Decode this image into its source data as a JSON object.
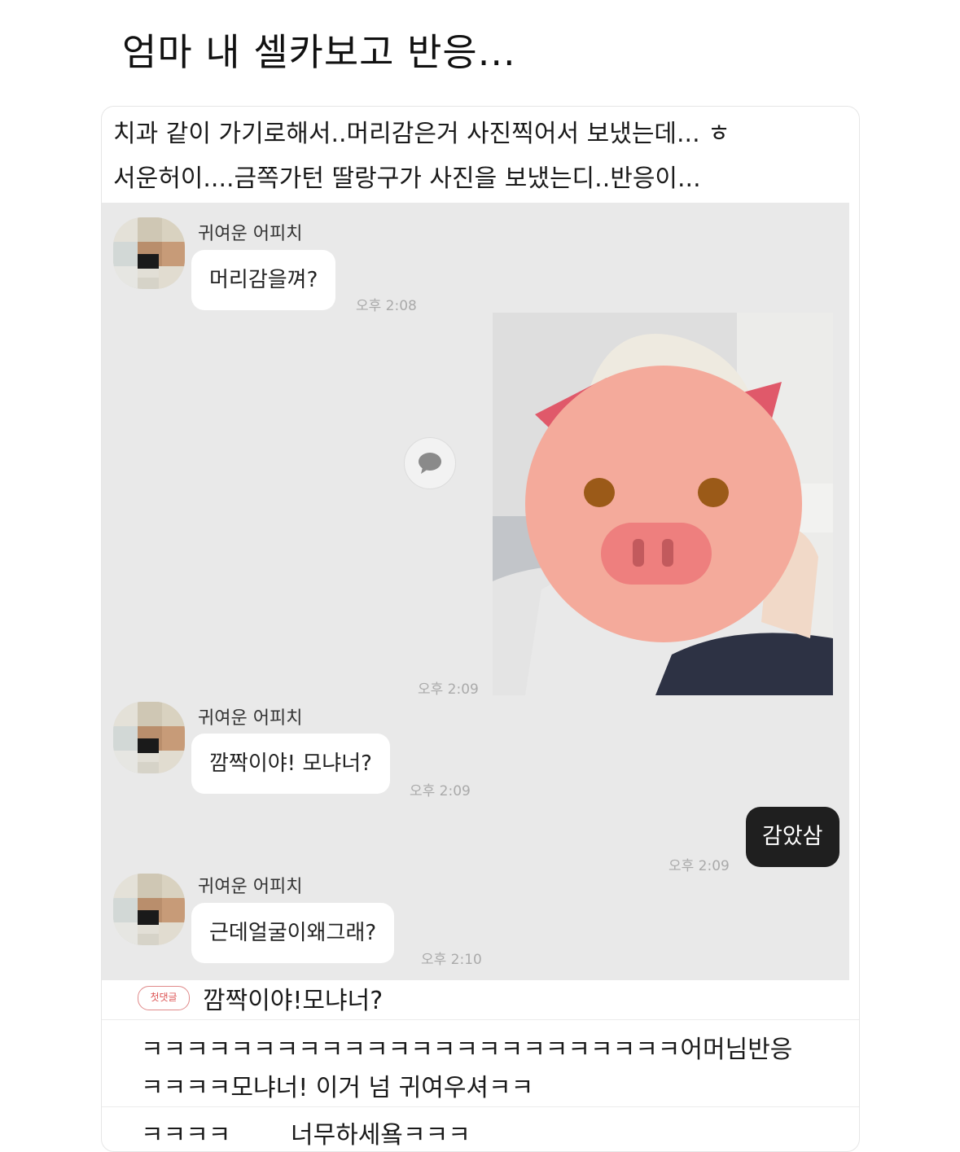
{
  "page_title": "엄마 내 셀카보고 반응...",
  "caption": {
    "line1": "치과 같이 가기로해서..머리감은거 사진찍어서 보냈는데... ㅎ",
    "line2": "서운허이....금쪽가턴 딸랑구가 사진을 보냈는디..반응이..."
  },
  "chat": {
    "messages": [
      {
        "sender": "귀여운 어피치",
        "text": "머리감을껴?",
        "time": "오후 2:08"
      },
      {
        "time": "오후 2:09"
      },
      {
        "sender": "귀여운 어피치",
        "text": "깜짝이야! 모냐너?",
        "time": "오후 2:09"
      },
      {
        "text": "감았삼",
        "time": "오후 2:09"
      },
      {
        "sender": "귀여운 어피치",
        "text": "근데얼굴이왜그래?",
        "time": "오후 2:10"
      }
    ]
  },
  "comments": {
    "badge": "첫댓글",
    "first": "깜짝이야!모냐너?",
    "second_line1": "ㅋㅋㅋㅋㅋㅋㅋㅋㅋㅋㅋㅋㅋㅋㅋㅋㅋㅋㅋㅋㅋㅋㅋㅋ어머님반응",
    "second_line2": "ㅋㅋㅋㅋ모냐너! 이거 넘 귀여우셔ㅋㅋ",
    "third_a": "ㅋㅋㅋㅋ",
    "third_b": "너무하세욬ㅋㅋㅋ"
  },
  "colors": {
    "chat_bg": "#e9e9e9",
    "bubble_in": "#ffffff",
    "bubble_out": "#1f1f1f",
    "pig_face": "#f4aa9b",
    "pig_snout": "#ee7f7e",
    "pig_ear": "#e0596a",
    "pig_eye": "#9b5a18"
  },
  "icons": [
    "speech-bubble-icon",
    "pig-face-sticker"
  ]
}
